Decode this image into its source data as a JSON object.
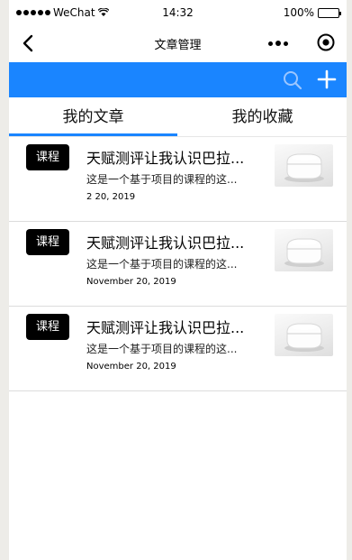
{
  "status_bar": {
    "carrier": "WeChat",
    "time": "14:32",
    "battery": "100%",
    "battery_level": 1.0
  },
  "navbar": {
    "title": "文章管理",
    "back_icon": "chevron-left-icon",
    "more_icon": "more-dots-icon",
    "target_icon": "target-circle-icon"
  },
  "actionbar": {
    "color": "#1a85ff",
    "search_icon": "search-icon",
    "add_icon": "plus-icon"
  },
  "tabs": [
    {
      "label": "我的文章",
      "active": true
    },
    {
      "label": "我的收藏",
      "active": false
    }
  ],
  "articles": [
    {
      "badge": "课程",
      "title": "天赋测评让我认识巴拉...",
      "desc": "这是一个基于项目的课程的这...",
      "date": "2 20, 2019",
      "thumb_icon": "earbud-case-image"
    },
    {
      "badge": "课程",
      "title": "天赋测评让我认识巴拉...",
      "desc": "这是一个基于项目的课程的这...",
      "date": "November 20, 2019",
      "thumb_icon": "earbud-case-image"
    },
    {
      "badge": "课程",
      "title": "天赋测评让我认识巴拉...",
      "desc": "这是一个基于项目的课程的这...",
      "date": "November 20, 2019",
      "thumb_icon": "earbud-case-image"
    }
  ]
}
